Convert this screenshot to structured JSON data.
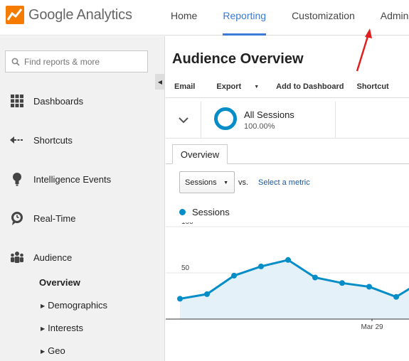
{
  "app": {
    "logo_text": "Google Analytics"
  },
  "nav": {
    "items": [
      "Home",
      "Reporting",
      "Customization",
      "Admin"
    ],
    "active": "Reporting"
  },
  "sidebar": {
    "search_placeholder": "Find reports & more",
    "items": [
      {
        "label": "Dashboards",
        "icon": "grid-icon"
      },
      {
        "label": "Shortcuts",
        "icon": "shortcut-arrow-icon"
      },
      {
        "label": "Intelligence Events",
        "icon": "lightbulb-icon"
      },
      {
        "label": "Real-Time",
        "icon": "clock-icon"
      },
      {
        "label": "Audience",
        "icon": "people-icon"
      }
    ],
    "sub_items": [
      "Overview",
      "Demographics",
      "Interests",
      "Geo"
    ]
  },
  "main": {
    "title": "Audience Overview",
    "toolbar": {
      "email": "Email",
      "export": "Export",
      "add_dashboard": "Add to Dashboard",
      "shortcut": "Shortcut"
    },
    "segment": {
      "label": "All Sessions",
      "percent": "100.00%"
    },
    "tab": "Overview",
    "metric_select": "Sessions",
    "vs": "vs.",
    "select_metric": "Select a metric",
    "legend": "Sessions"
  },
  "colors": {
    "accent": "#3a7bd5",
    "series": "#058dc7",
    "area": "#e5f1f8",
    "annotation": "#e02020"
  },
  "chart_data": {
    "type": "area",
    "series": [
      {
        "name": "Sessions",
        "values": [
          22,
          27,
          47,
          57,
          64,
          45,
          39,
          35,
          24,
          42
        ]
      }
    ],
    "y_ticks": [
      "100",
      "50"
    ],
    "x_tick_labels": [
      "Mar 29"
    ],
    "ylim": [
      0,
      100
    ]
  }
}
